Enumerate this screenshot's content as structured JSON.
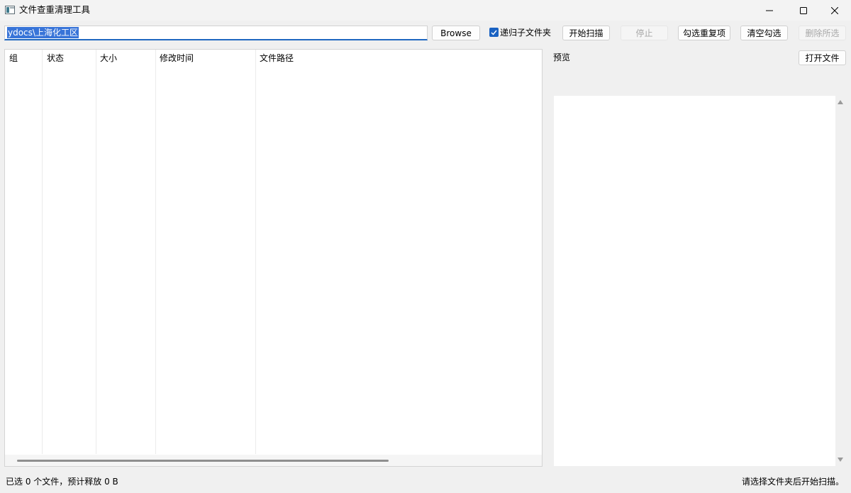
{
  "window": {
    "title": "文件查重清理工具",
    "icons": {
      "app": "app-icon",
      "minimize": "minimize-icon",
      "maximize": "maximize-icon",
      "close": "close-icon"
    }
  },
  "toolbar": {
    "path_value": "ydocs\\上海化工区",
    "browse_label": "Browse",
    "recurse_label": "递归子文件夹",
    "recurse_checked": true,
    "start_label": "开始扫描",
    "stop_label": "停止",
    "select_dup_label": "勾选重复项",
    "clear_label": "清空勾选",
    "delete_label": "删除所选"
  },
  "table": {
    "columns": [
      "组",
      "状态",
      "大小",
      "修改时间",
      "文件路径"
    ],
    "rows": []
  },
  "preview": {
    "label": "预览",
    "open_file_label": "打开文件"
  },
  "status": {
    "left": "已选 0 个文件，预计释放 0 B",
    "right": "请选择文件夹后开始扫描。"
  },
  "colors": {
    "accent": "#1a62c2",
    "selection": "#3874d8",
    "window_bg": "#f0f0f0"
  }
}
